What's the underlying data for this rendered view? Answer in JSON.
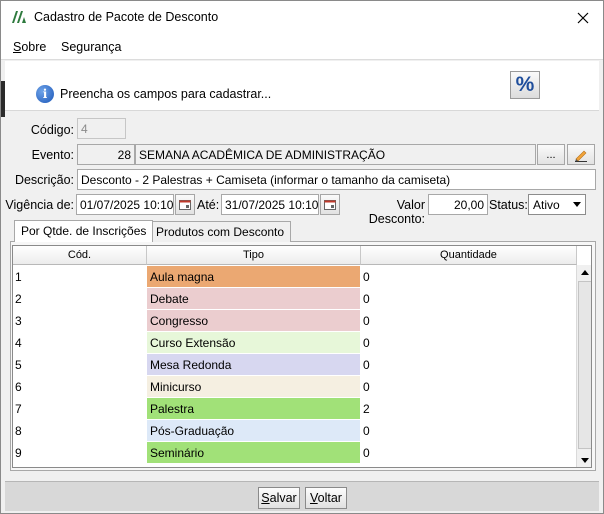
{
  "window": {
    "title": "Cadastro de Pacote de Desconto",
    "close_glyph": "✕"
  },
  "menu": {
    "items": [
      {
        "label": "Sobre",
        "mnemonic": "S",
        "rest": "obre"
      },
      {
        "label": "Segurança",
        "mnemonic": "",
        "rest": "Segurança"
      }
    ]
  },
  "banner": {
    "message": "Preencha os campos para cadastrar...",
    "info_glyph": "i",
    "percent_glyph": "%"
  },
  "form": {
    "codigo_label": "Código:",
    "codigo_value": "4",
    "evento_label": "Evento:",
    "evento_id": "28",
    "evento_name": "SEMANA ACADÊMICA DE ADMINISTRAÇÃO",
    "browse_label": "...",
    "descricao_label": "Descrição:",
    "descricao_value": "Desconto - 2 Palestras + Camiseta (informar o tamanho da camiseta)",
    "vigencia_label": "Vigência de:",
    "vigencia_de": "01/07/2025 10:10",
    "ate_label": "Até:",
    "vigencia_ate": "31/07/2025 10:10",
    "valor_label": "Valor Desconto:",
    "valor_value": "20,00",
    "status_label": "Status:",
    "status_value": "Ativo"
  },
  "tabs": [
    {
      "label": "Por Qtde. de Inscrições",
      "active": true
    },
    {
      "label": "Produtos com Desconto",
      "active": false
    }
  ],
  "grid": {
    "columns": [
      "Cód.",
      "Tipo",
      "Quantidade"
    ],
    "rows": [
      {
        "cod": "1",
        "tipo": "Aula magna",
        "qtd": "0",
        "color": "#eba872"
      },
      {
        "cod": "2",
        "tipo": "Debate",
        "qtd": "0",
        "color": "#ebcdcf"
      },
      {
        "cod": "3",
        "tipo": "Congresso",
        "qtd": "0",
        "color": "#ebcdcf"
      },
      {
        "cod": "4",
        "tipo": "Curso Extensão",
        "qtd": "0",
        "color": "#e7f7d9"
      },
      {
        "cod": "5",
        "tipo": "Mesa Redonda",
        "qtd": "0",
        "color": "#d7d7f0"
      },
      {
        "cod": "6",
        "tipo": "Minicurso",
        "qtd": "0",
        "color": "#f5efe1"
      },
      {
        "cod": "7",
        "tipo": "Palestra",
        "qtd": "2",
        "color": "#a1e178"
      },
      {
        "cod": "8",
        "tipo": "Pós-Graduação",
        "qtd": "0",
        "color": "#dde9f8"
      },
      {
        "cod": "9",
        "tipo": "Seminário",
        "qtd": "0",
        "color": "#a1e178"
      }
    ]
  },
  "footer": {
    "salvar": {
      "mnemonic": "S",
      "rest": "alvar"
    },
    "voltar": {
      "mnemonic": "V",
      "rest": "oltar"
    }
  }
}
